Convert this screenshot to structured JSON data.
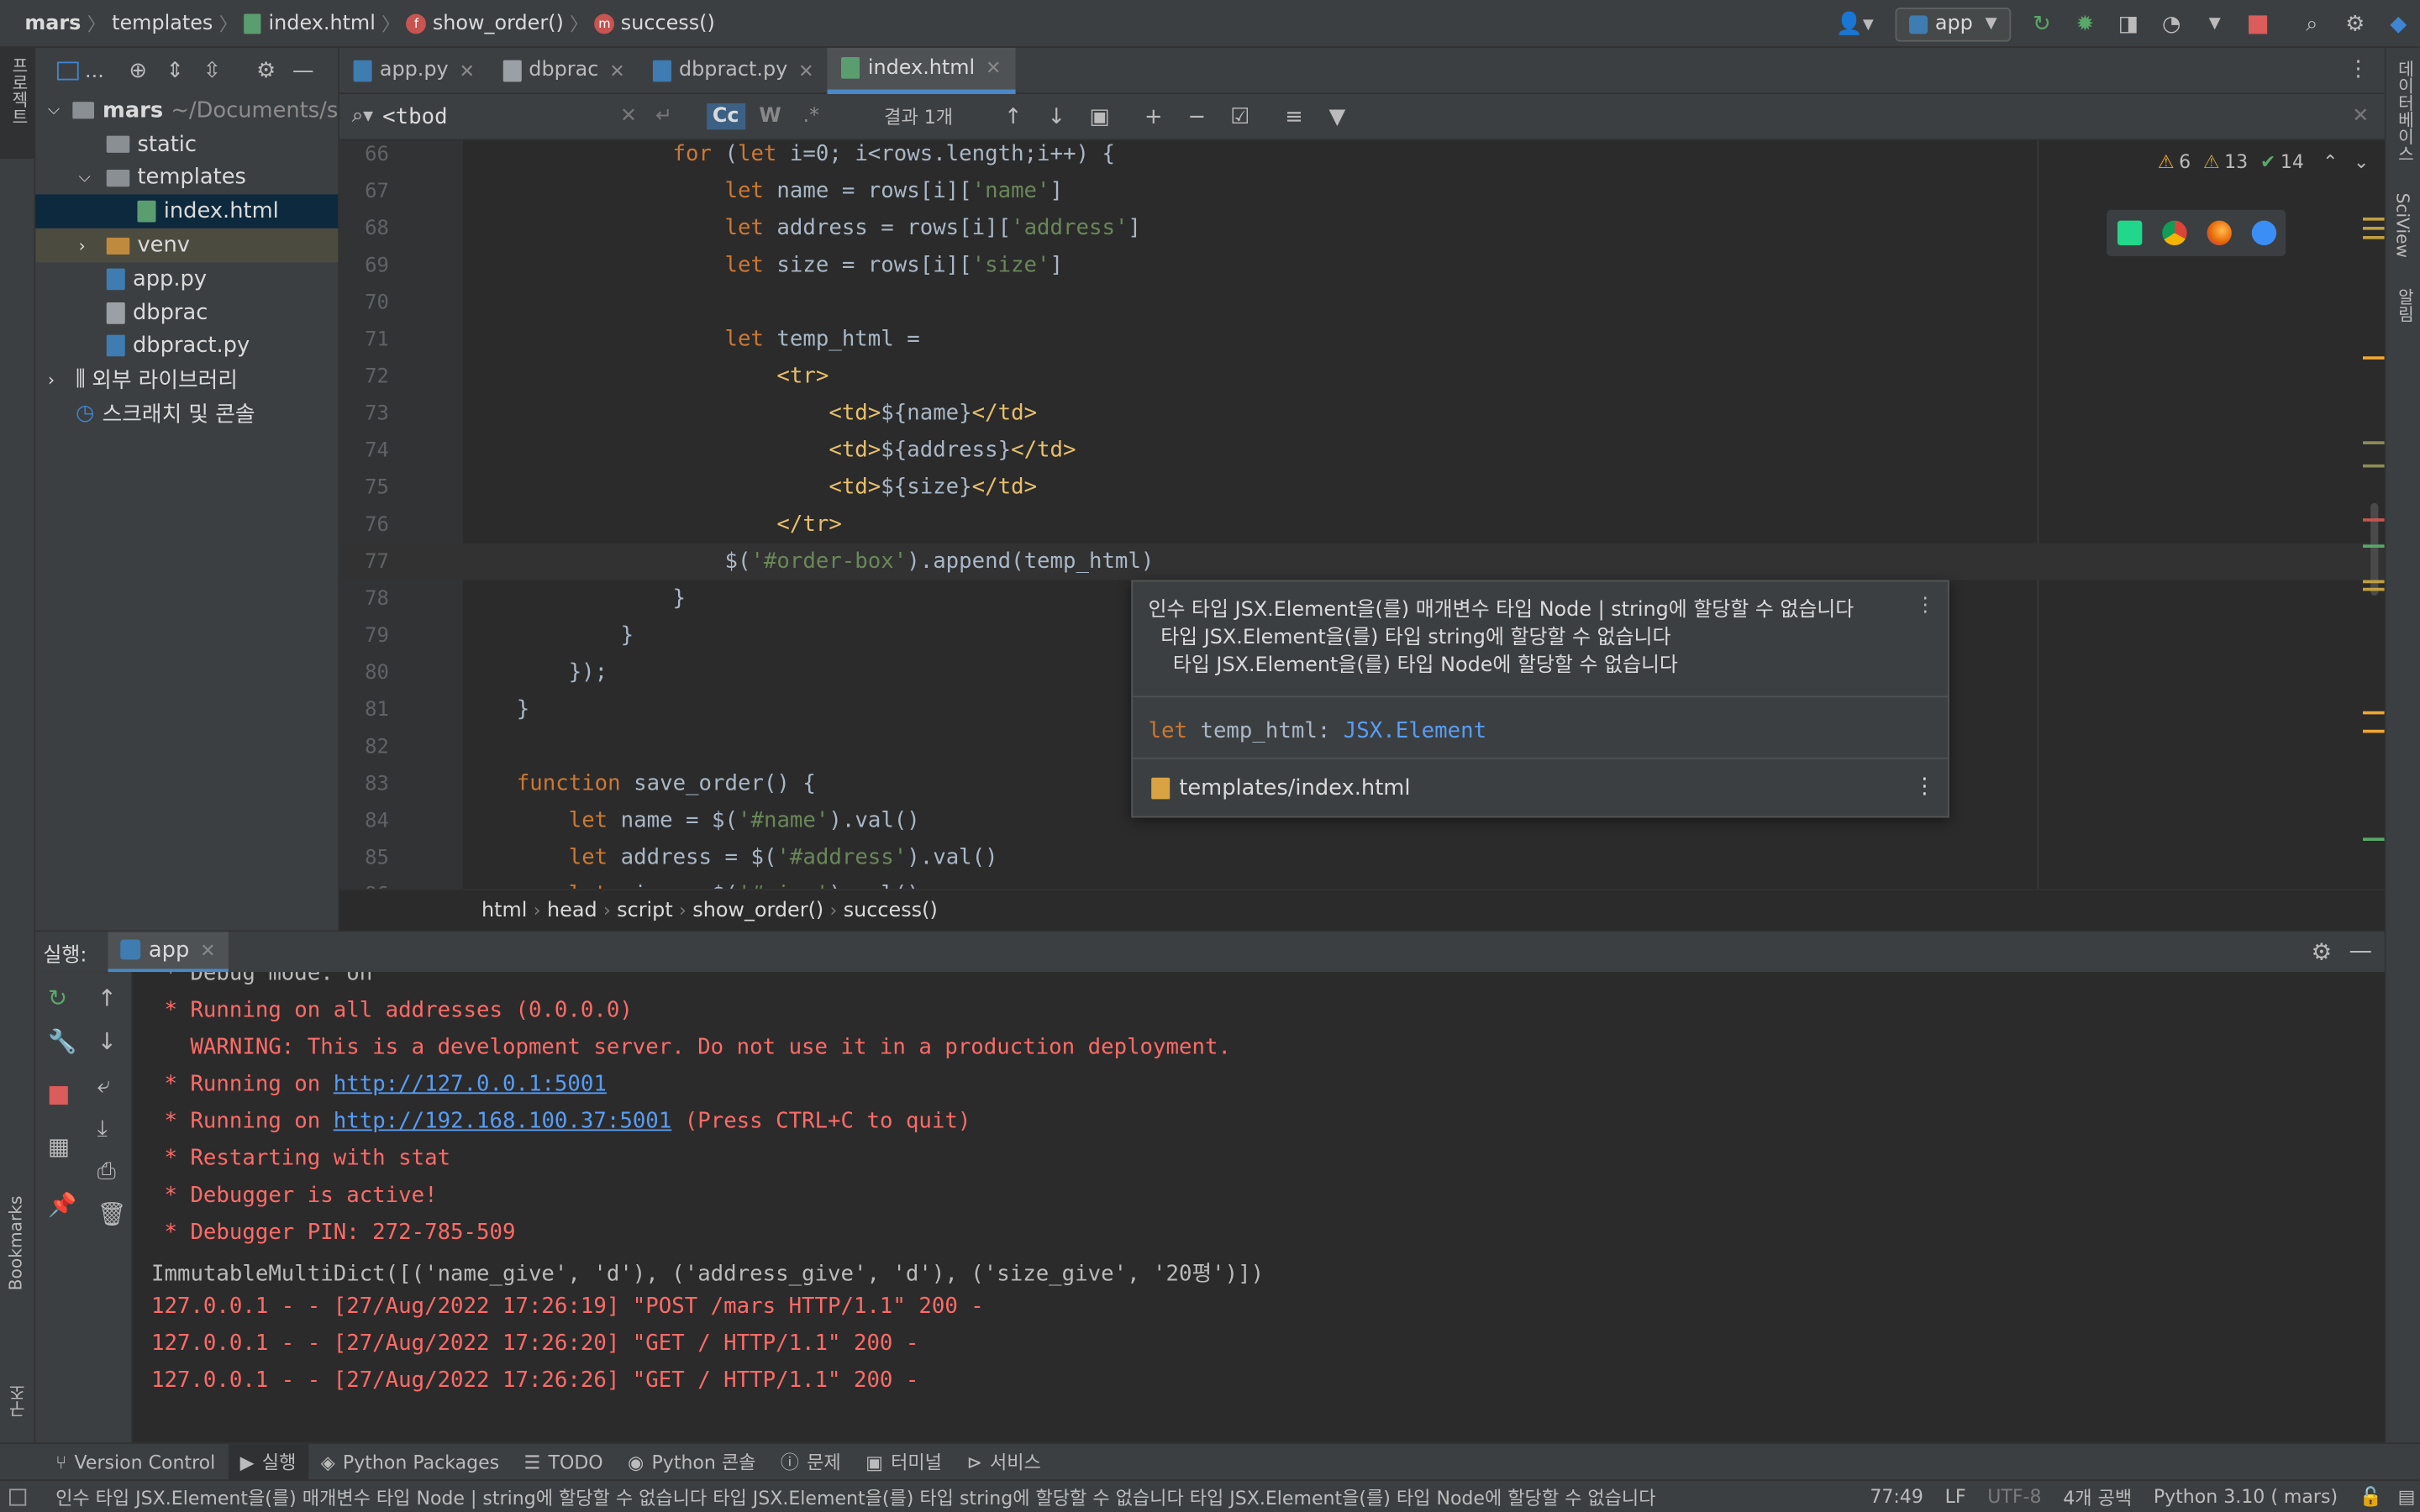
{
  "navbar": {
    "breadcrumbs": [
      "mars",
      "templates",
      "index.html",
      "show_order()",
      "success()"
    ],
    "run_config": "app"
  },
  "project_panel": {
    "ellipsis": "...",
    "root_name": "mars",
    "root_path": "~/Documents/s",
    "items": [
      {
        "label": "static",
        "type": "folder",
        "depth": 1
      },
      {
        "label": "templates",
        "type": "folder",
        "depth": 1
      },
      {
        "label": "index.html",
        "type": "html",
        "depth": 2
      },
      {
        "label": "venv",
        "type": "folder",
        "depth": 1
      },
      {
        "label": "app.py",
        "type": "python",
        "depth": 1
      },
      {
        "label": "dbprac",
        "type": "file",
        "depth": 1
      },
      {
        "label": "dbpract.py",
        "type": "python",
        "depth": 1
      },
      {
        "label": "외부 라이브러리",
        "type": "library",
        "depth": 0
      },
      {
        "label": "스크래치 및 콘솔",
        "type": "scratch",
        "depth": 0
      }
    ]
  },
  "left_strip_label": "프로젝트",
  "left_bottom_labels": [
    "Bookmarks",
    "구조"
  ],
  "right_strip_labels": [
    "데이터베이스",
    "SciView",
    "알림"
  ],
  "tabs": [
    "app.py",
    "dbprac",
    "dbpract.py",
    "index.html"
  ],
  "search": {
    "query": "<tbod",
    "case_label": "Cc",
    "word_label": "W",
    "regex_label": ".*",
    "result": "결과 1개"
  },
  "inspections": {
    "warn1": "6",
    "warn2": "13",
    "ok": "14"
  },
  "code_lines": [
    {
      "n": "66",
      "text": "                for (let i=0; i<rows.length;i++) {"
    },
    {
      "n": "67",
      "text": "                    let name = rows[i]['name']"
    },
    {
      "n": "68",
      "text": "                    let address = rows[i]['address']"
    },
    {
      "n": "69",
      "text": "                    let size = rows[i]['size']"
    },
    {
      "n": "70",
      "text": ""
    },
    {
      "n": "71",
      "text": "                    let temp_html ="
    },
    {
      "n": "72",
      "text": "                        <tr>"
    },
    {
      "n": "73",
      "text": "                            <td>${name}</td>"
    },
    {
      "n": "74",
      "text": "                            <td>${address}</td>"
    },
    {
      "n": "75",
      "text": "                            <td>${size}</td>"
    },
    {
      "n": "76",
      "text": "                        </tr>"
    },
    {
      "n": "77",
      "text": "                    $('#order-box').append(temp_html)"
    },
    {
      "n": "78",
      "text": "                }"
    },
    {
      "n": "79",
      "text": "            }"
    },
    {
      "n": "80",
      "text": "        });"
    },
    {
      "n": "81",
      "text": "    }"
    },
    {
      "n": "82",
      "text": ""
    },
    {
      "n": "83",
      "text": "    function save_order() {"
    },
    {
      "n": "84",
      "text": "        let name = $('#name').val()"
    },
    {
      "n": "85",
      "text": "        let address = $('#address').val()"
    },
    {
      "n": "86",
      "text": "        let size = $('#size').val()"
    }
  ],
  "popup": {
    "line1": "인수 타입 JSX.Element을(를) 매개변수 타입 Node | string에 할당할 수 없습니다",
    "line2": "타입 JSX.Element을(를) 타입 string에 할당할 수 없습니다",
    "line3": "타입 JSX.Element을(를) 타입 Node에 할당할 수 없습니다",
    "decl_kw": "let",
    "decl_name": "temp_html:",
    "decl_type": "JSX.Element",
    "file": "templates/index.html"
  },
  "code_breadcrumbs": [
    "html",
    "head",
    "script",
    "show_order()",
    "success()"
  ],
  "run_panel": {
    "label": "실행:",
    "tab": "app"
  },
  "console_lines": [
    {
      "text": " * Debug mode: on",
      "style": "wtext"
    },
    {
      "text": " * Running on all addresses (0.0.0.0)",
      "style": "red"
    },
    {
      "text": "   WARNING: This is a development server. Do not use it in a production deployment.",
      "style": "red"
    },
    {
      "text": " * Running on ",
      "style": "red",
      "link": "http://127.0.0.1:5001",
      "after": ""
    },
    {
      "text": " * Running on ",
      "style": "red",
      "link": "http://192.168.100.37:5001",
      "after": " (Press CTRL+C to quit)"
    },
    {
      "text": " * Restarting with stat",
      "style": "red"
    },
    {
      "text": " * Debugger is active!",
      "style": "red"
    },
    {
      "text": " * Debugger PIN: 272-785-509",
      "style": "red"
    },
    {
      "text": "ImmutableMultiDict([('name_give', 'd'), ('address_give', 'd'), ('size_give', '20평')])",
      "style": "wtext"
    },
    {
      "text": "127.0.0.1 - - [27/Aug/2022 17:26:19] \"POST /mars HTTP/1.1\" 200 -",
      "style": "red"
    },
    {
      "text": "127.0.0.1 - - [27/Aug/2022 17:26:20] \"GET / HTTP/1.1\" 200 -",
      "style": "red"
    },
    {
      "text": "127.0.0.1 - - [27/Aug/2022 17:26:26] \"GET / HTTP/1.1\" 200 -",
      "style": "red"
    }
  ],
  "bottom_tabs": [
    "Version Control",
    "실행",
    "Python Packages",
    "TODO",
    "Python 콘솔",
    "문제",
    "터미널",
    "서비스"
  ],
  "status_bar": {
    "message": "인수 타입 JSX.Element을(를) 매개변수 타입 Node | string에 할당할 수 없습니다  타입 JSX.Element을(를) 타입 string에 할당할 수 없습니다    타입 JSX.Element을(를) 타입 Node에 할당할 수 없습니다",
    "position": "77:49",
    "line_sep": "LF",
    "encoding": "UTF-8",
    "indent": "4개 공백",
    "interpreter": "Python 3.10 ( mars)"
  },
  "colors": {
    "accent": "#4a88c7",
    "keyword": "#cc7832",
    "string": "#6a8759",
    "error_red": "#ff6b68",
    "link": "#589df6"
  }
}
